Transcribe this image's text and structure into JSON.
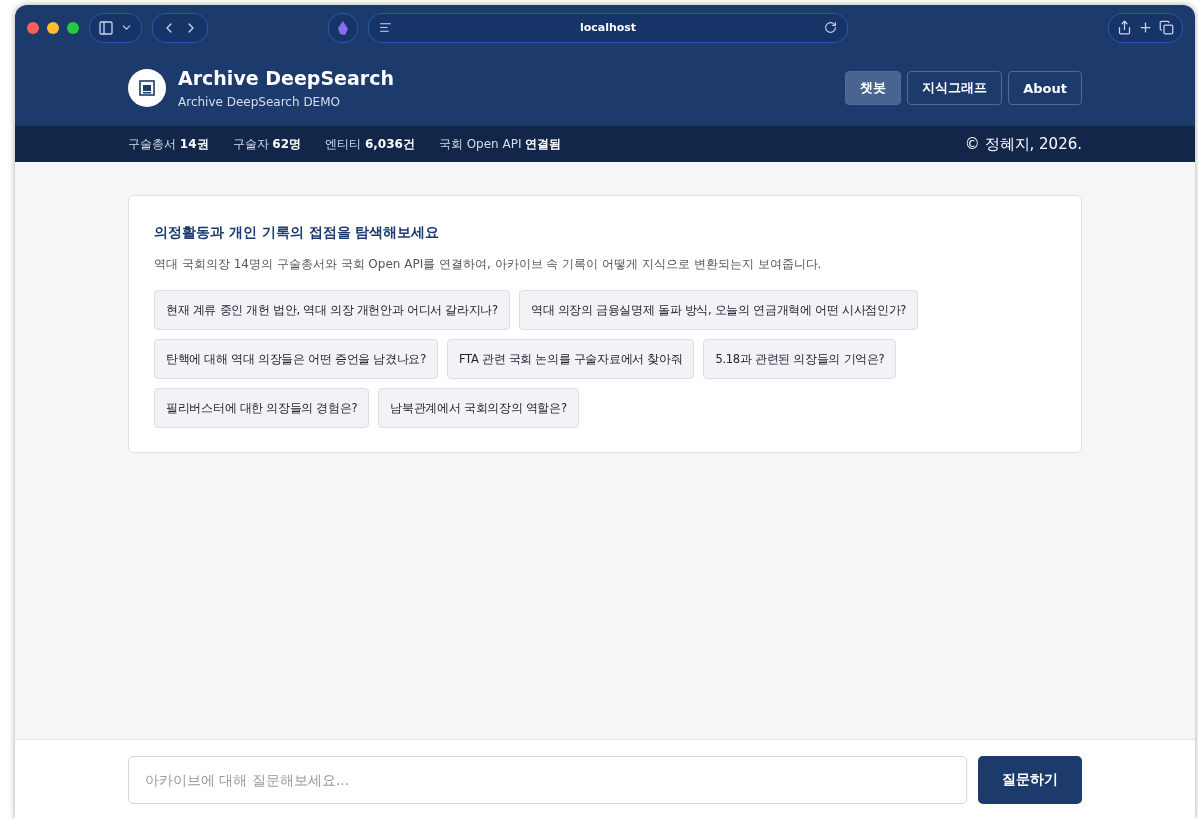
{
  "browser": {
    "address": "localhost"
  },
  "header": {
    "title": "Archive DeepSearch",
    "subtitle": "Archive DeepSearch DEMO",
    "nav": [
      {
        "label": "챗봇",
        "selected": true
      },
      {
        "label": "지식그래프",
        "selected": false
      },
      {
        "label": "About",
        "selected": false
      }
    ]
  },
  "stats": [
    "구술총서 **14권**",
    "구술자 **62명**",
    "엔티티 **6,036건**",
    "국회 Open API **연결됨**"
  ],
  "copyright": "© 정혜지, 2026.",
  "intro": {
    "heading": "의정활동과 개인 기록의 접점을 탐색해보세요",
    "description": "역대 국회의장 14명의 구술총서와 국회 Open API를 연결하여, 아카이브 속 기록이 어떻게 지식으로 변환되는지 보여줍니다.",
    "suggestions": [
      "현재 계류 중인 개헌 법안, 역대 의장 개헌안과 어디서 갈라지나?",
      "역대 의장의 금융실명제 돌파 방식, 오늘의 연금개혁에 어떤 시사점인가?",
      "탄핵에 대해 역대 의장들은 어떤 증언을 남겼나요?",
      "FTA 관련 국회 논의를 구술자료에서 찾아줘",
      "5.18과 관련된 의장들의 기억은?",
      "필리버스터에 대한 의장들의 경험은?",
      "남북관계에서 국회의장의 역할은?"
    ]
  },
  "composer": {
    "placeholder": "아카이브에 대해 질문해보세요...",
    "button": "질문하기"
  }
}
